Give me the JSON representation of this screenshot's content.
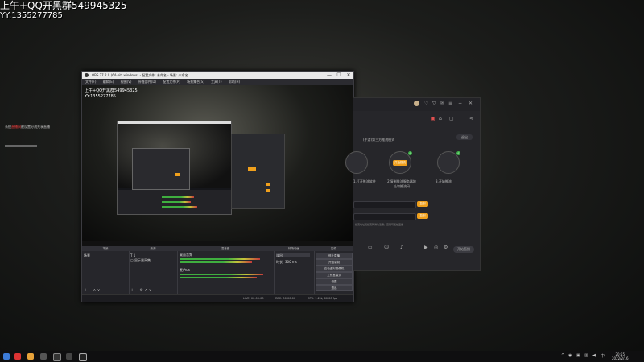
{
  "overlay": {
    "line1": "上午+QQ开黑群549945325",
    "line2": "YY:1355277785",
    "chat_prefix": "系统",
    "chat_highlight": "直播间",
    "chat_rest": "被设置分流共享直播"
  },
  "obs": {
    "title": "OBS 27.2.0 (64-bit, windows) - 配置文件: 未命名 - 场景: 未命名",
    "minimize": "—",
    "maximize": "☐",
    "close": "✕",
    "menu": [
      "文件(F)",
      "编辑(E)",
      "视图(V)",
      "停靠部件(D)",
      "配置文件(P)",
      "场景集合(S)",
      "工具(T)",
      "帮助(H)"
    ],
    "preview_text_line1": "上午+QQ开黑群549945325",
    "preview_text_line2": "YY:1355277785",
    "docks": {
      "scenes": {
        "header": "场景",
        "items": [
          "场景"
        ]
      },
      "sources": {
        "header": "来源",
        "items": [
          "T  1",
          "▢ 显示器采集"
        ]
      },
      "mixer": {
        "header": "混音器",
        "items": [
          "桌面音频",
          "麦/Aux"
        ]
      },
      "transitions": {
        "header": "转场动画",
        "type": "淡出",
        "duration_label": "时长",
        "duration": "300 ms"
      },
      "controls": {
        "header": "控件",
        "buttons": [
          "停止直播",
          "开始录制",
          "启动虚拟摄像机",
          "工作室模式",
          "设置",
          "退出"
        ]
      }
    },
    "status": {
      "live": "LIVE: 00:00:00",
      "rec": "REC: 00:00:00",
      "cpu": "CPU: 1.2%, 60.00 fps"
    }
  },
  "stream_app": {
    "mode_label": "(手游)第三方推流模式",
    "exit": "退出",
    "steps": [
      "1.打开推流软件",
      "2.复制推流服务器地址和推流码",
      "3.开始推流"
    ],
    "step_button": "开始推流",
    "copy_label": "复制",
    "copy_label2": "复制",
    "hint": "推流地址和推流码请勿泄露，否则可能被盗播",
    "start_live": "开始直播"
  },
  "taskbar": {
    "time": "20:55",
    "date": "2022/2/16"
  },
  "colors": {
    "accent": "#f0a01c",
    "green": "#3fb34a"
  }
}
